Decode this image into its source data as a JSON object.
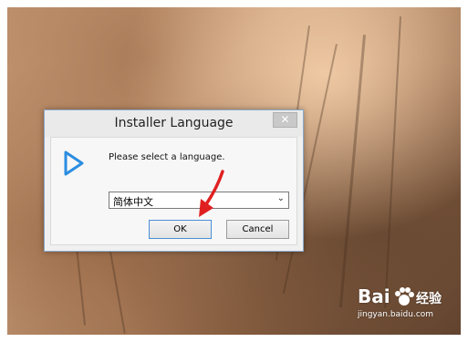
{
  "dialog": {
    "title": "Installer Language",
    "close_glyph": "✕",
    "icon": "play-triangle-icon",
    "prompt": "Please select a language.",
    "language_select": {
      "value": "简体中文"
    },
    "ok_label": "OK",
    "cancel_label": "Cancel"
  },
  "watermark": {
    "brand": "Bai",
    "brand_cn": "经验",
    "url": "jingyan.baidu.com"
  },
  "colors": {
    "icon_blue": "#2a8de0",
    "annotation_arrow": "#e02020"
  }
}
